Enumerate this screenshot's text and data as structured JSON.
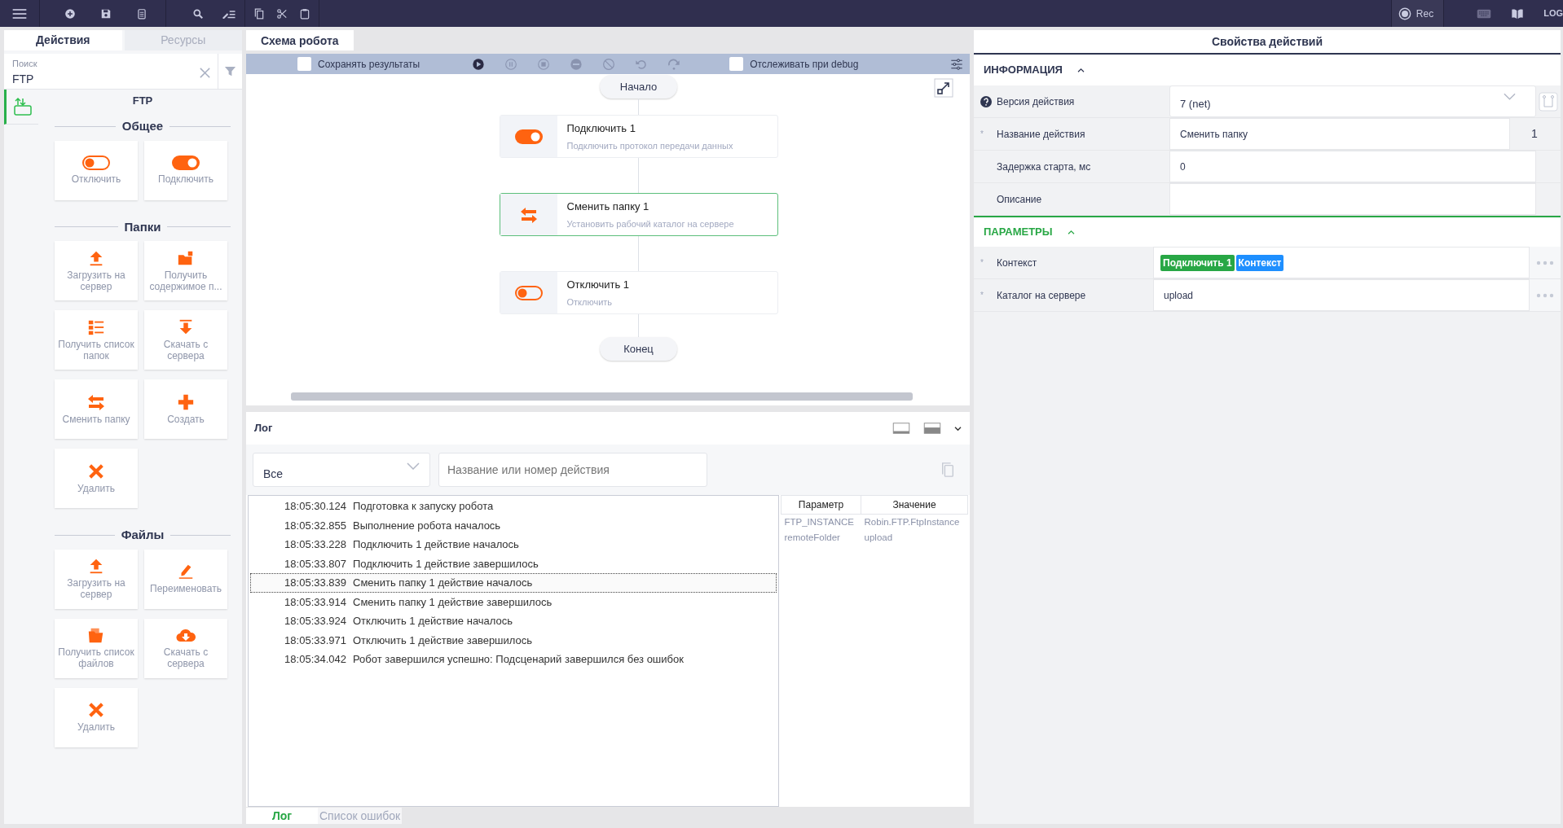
{
  "top_toolbar": {
    "record_label": "Rec",
    "log_label": "LOG"
  },
  "left_panel": {
    "tabs": [
      {
        "label": "Действия",
        "selected": true
      },
      {
        "label": "Ресурсы",
        "selected": false
      }
    ],
    "search": {
      "label": "Поиск",
      "value": "FTP"
    },
    "category": {
      "title": "FTP",
      "selected": true
    },
    "groups": [
      {
        "title": "Общее",
        "actions": [
          {
            "label": "Отключить",
            "kind": "off"
          },
          {
            "label": "Подключить",
            "kind": "on"
          }
        ]
      },
      {
        "title": "Папки",
        "actions": [
          {
            "label": "Загрузить на сервер",
            "kind": "upload"
          },
          {
            "label": "Получить содержимое п...",
            "kind": "folder"
          },
          {
            "label": "Получить список папок",
            "kind": "list"
          },
          {
            "label": "Скачать с сервера",
            "kind": "download"
          },
          {
            "label": "Сменить папку",
            "kind": "swap"
          },
          {
            "label": "Создать",
            "kind": "plus"
          },
          {
            "label": "Удалить",
            "kind": "cross"
          }
        ]
      },
      {
        "title": "Файлы",
        "actions": [
          {
            "label": "Загрузить на сервер",
            "kind": "upload"
          },
          {
            "label": "Переименовать",
            "kind": "pencil"
          },
          {
            "label": "Получить список файлов",
            "kind": "files"
          },
          {
            "label": "Скачать с сервера",
            "kind": "cloud"
          },
          {
            "label": "Удалить",
            "kind": "cross"
          }
        ]
      }
    ]
  },
  "editor": {
    "tab": "Схема робота",
    "save_results": {
      "label": "Сохранять результаты",
      "checked": false
    },
    "controls": [
      {
        "kind": "play",
        "disabled": false
      },
      {
        "kind": "pause",
        "disabled": true
      },
      {
        "kind": "stop",
        "disabled": true
      },
      {
        "kind": "block",
        "disabled": true
      },
      {
        "kind": "ban",
        "disabled": true
      },
      {
        "kind": "undo",
        "disabled": true
      },
      {
        "kind": "redo",
        "disabled": true
      }
    ],
    "debug_tracking": {
      "label": "Отслеживать при debug",
      "checked": false
    },
    "flow": [
      {
        "kind": "start",
        "label": "Начало"
      },
      {
        "kind": "action",
        "title": "Подключить 1",
        "subtitle": "Подключить протокол передачи данных",
        "selected": false,
        "icon": {
          "kind": "on"
        }
      },
      {
        "kind": "action",
        "title": "Сменить папку 1",
        "subtitle": "Установить рабочий каталог на сервере",
        "selected": true,
        "icon": {
          "kind": "swap"
        }
      },
      {
        "kind": "action",
        "title": "Отключить 1",
        "subtitle": "Отключить",
        "selected": false,
        "icon": {
          "kind": "off"
        }
      },
      {
        "kind": "end",
        "label": "Конец"
      }
    ]
  },
  "log": {
    "title": "Лог",
    "filter": {
      "value": "Все"
    },
    "search": {
      "placeholder": "Название или номер действия"
    },
    "entries": [
      {
        "time": "18:05:30.124",
        "message": "Подготовка к запуску робота",
        "selected": false
      },
      {
        "time": "18:05:32.855",
        "message": "Выполнение робота началось",
        "selected": false
      },
      {
        "time": "18:05:33.228",
        "message": "Подключить 1 действие началось",
        "selected": false
      },
      {
        "time": "18:05:33.807",
        "message": "Подключить 1 действие завершилось",
        "selected": false
      },
      {
        "time": "18:05:33.839",
        "message": "Сменить папку 1 действие началось",
        "selected": true
      },
      {
        "time": "18:05:33.914",
        "message": "Сменить папку 1 действие завершилось",
        "selected": false
      },
      {
        "time": "18:05:33.924",
        "message": "Отключить 1 действие началось",
        "selected": false
      },
      {
        "time": "18:05:33.971",
        "message": "Отключить 1 действие завершилось",
        "selected": false
      },
      {
        "time": "18:05:34.042",
        "message": "Робот завершился успешно: Подсценарий завершился без ошибок",
        "selected": false
      }
    ],
    "details": {
      "columns": [
        "Параметр",
        "Значение"
      ],
      "rows": [
        [
          "FTP_INSTANCE",
          "Robin.FTP.FtpInstance"
        ],
        [
          "remoteFolder",
          "upload"
        ]
      ]
    },
    "tabs": [
      {
        "label": "Лог",
        "selected": true
      },
      {
        "label": "Список ошибок",
        "selected": false
      }
    ]
  },
  "properties": {
    "title": "Свойства действий",
    "sections": [
      {
        "kind": "info",
        "title": "ИНФОРМАЦИЯ",
        "expanded": true,
        "highlighted": false,
        "rows": [
          {
            "kind": "select",
            "label": "Версия действия",
            "value": "7 (net)"
          },
          {
            "kind": "text",
            "marker": "*",
            "label": "Название действия",
            "value": "Сменить папку",
            "suffix": "1"
          },
          {
            "kind": "text",
            "label": "Задержка старта, мс",
            "value": "0"
          },
          {
            "kind": "text",
            "label": "Описание"
          }
        ]
      },
      {
        "kind": "params",
        "title": "ПАРАМЕТРЫ",
        "expanded": true,
        "highlighted": true,
        "rows": [
          {
            "kind": "tokens",
            "marker": "*",
            "label": "Контекст",
            "tokens": [
              {
                "text": "Подключить 1",
                "color": "#28a745"
              },
              {
                "text": "Контекст",
                "color": "#1e8fff"
              }
            ]
          },
          {
            "kind": "text",
            "marker": "*",
            "label": "Каталог на сервере",
            "value": "upload"
          }
        ]
      }
    ]
  }
}
